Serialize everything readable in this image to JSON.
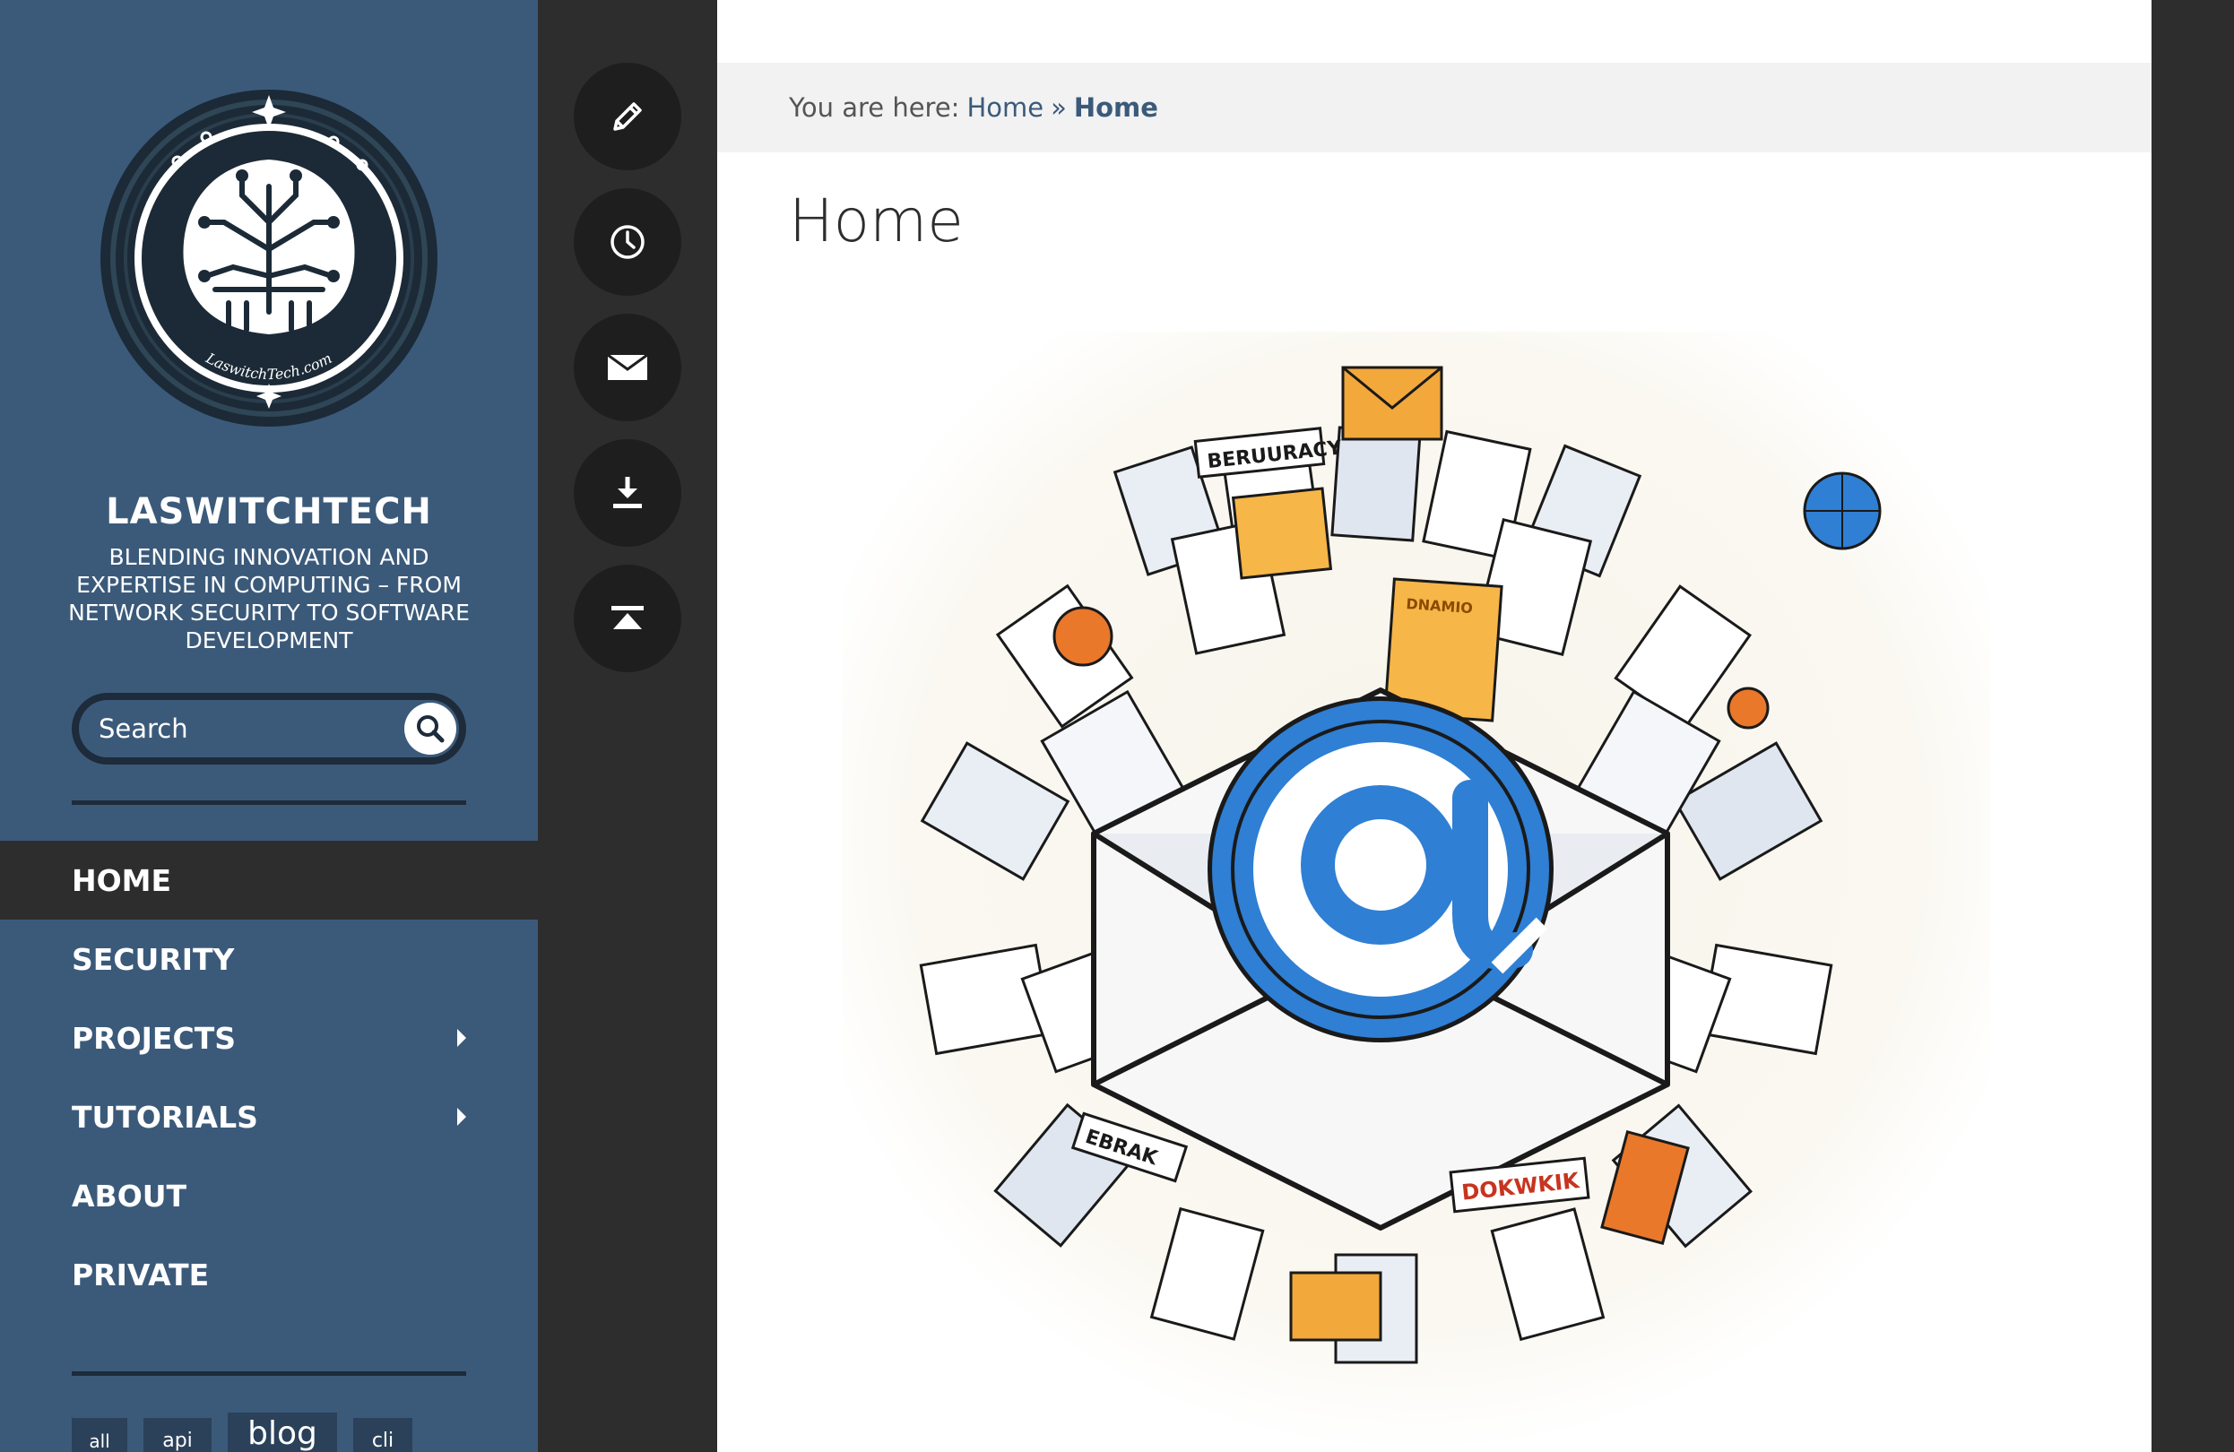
{
  "site": {
    "logo_text": "LaswitchTech.com",
    "title": "LASWITCHTECH",
    "tagline": "BLENDING INNOVATION AND EXPERTISE IN COMPUTING – FROM NETWORK SECURITY TO SOFTWARE DEVELOPMENT"
  },
  "search": {
    "placeholder": "Search",
    "icon": "search-icon"
  },
  "nav": {
    "items": [
      {
        "label": "HOME",
        "active": true,
        "has_submenu": false
      },
      {
        "label": "SECURITY",
        "active": false,
        "has_submenu": false
      },
      {
        "label": "PROJECTS",
        "active": false,
        "has_submenu": true
      },
      {
        "label": "TUTORIALS",
        "active": false,
        "has_submenu": true
      },
      {
        "label": "ABOUT",
        "active": false,
        "has_submenu": false
      },
      {
        "label": "PRIVATE",
        "active": false,
        "has_submenu": false
      }
    ]
  },
  "tags": [
    "all",
    "api",
    "blog",
    "cli"
  ],
  "icon_column": [
    "pencil-icon",
    "clock-icon",
    "mail-icon",
    "download-icon",
    "to-top-icon"
  ],
  "breadcrumb": {
    "prefix": "You are here:",
    "link": "Home",
    "separator": "»",
    "current": "Home"
  },
  "page": {
    "title": "Home",
    "hero_labels": [
      "BERUURACY",
      "DNAMIO",
      "EBRAK",
      "DOKWKIK"
    ]
  },
  "colors": {
    "sidebar": "#3b5a7a",
    "sidebar_dark": "#1d2b3a",
    "active_nav": "#2d2d2d",
    "main_bg": "#ffffff",
    "accent": "#3b5a7a"
  }
}
